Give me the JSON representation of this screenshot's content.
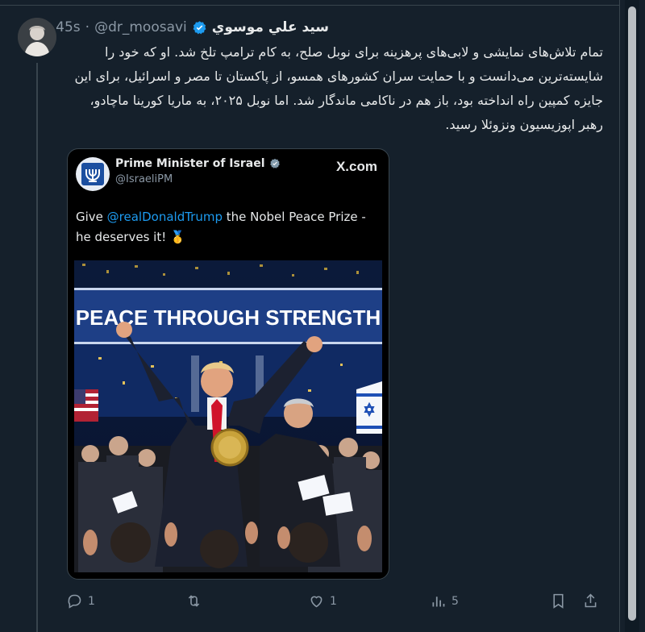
{
  "tweet": {
    "display_name": "سيد علي موسوي",
    "handle": "@dr_moosavi",
    "separator": "·",
    "time": "45s",
    "text": "تمام تلاش‌های نمایشی و لابی‌های پرهزینه برای نوبل صلح، به کام ترامپ تلخ شد. او که خود را شایسته‌ترین می‌دانست و با حمایت سران کشورهای همسو، از پاکستان تا مصر و اسرائیل، برای این جایزه کمپین راه انداخته بود، باز هم در ناکامی ماندگار شد. اما نوبل ۲۰۲۵، به ماریا کورینا ماچادو، رهبر اپوزیسیون ونزوئلا رسید."
  },
  "embed": {
    "name": "Prime Minister of Israel",
    "handle": "@IsraeliPM",
    "brand": "X.com",
    "text_prefix": "Give ",
    "mention": "@realDonaldTrump",
    "text_suffix": " the Nobel Peace Prize - he deserves it! 🥇",
    "banner": "PEACE THROUGH STRENGTH"
  },
  "actions": {
    "replies": "1",
    "retweets": "",
    "likes": "1",
    "views": "5"
  },
  "colors": {
    "background": "#15202b",
    "accent": "#1d9bf0",
    "muted": "#8b98a5"
  },
  "icons": [
    "verified-badge-icon",
    "reply-icon",
    "retweet-icon",
    "like-icon",
    "views-icon",
    "bookmark-icon",
    "share-icon",
    "menorah-emblem-icon"
  ]
}
